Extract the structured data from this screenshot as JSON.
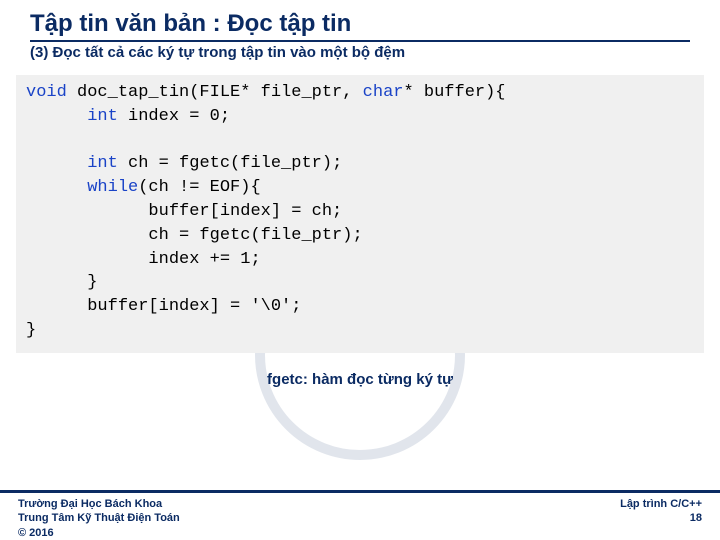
{
  "title": "Tập tin văn bản : Đọc tập tin",
  "subtitle": "(3) Đọc tất cả các ký tự trong tập tin vào một bộ đệm",
  "code": {
    "kw_void": "void",
    "sig": " doc_tap_tin(FILE* file_ptr, ",
    "kw_char": "char",
    "sig2": "* buffer){",
    "kw_int1": "int",
    "l2": " index = 0;",
    "kw_int2": "int",
    "l4": " ch = fgetc(file_ptr);",
    "kw_while": "while",
    "l5": "(ch != EOF){",
    "l6": "buffer[index] = ch;",
    "l7": "ch = fgetc(file_ptr);",
    "l8": "index += 1;",
    "l9": "}",
    "l10": "buffer[index] = '\\0';",
    "l11": "}"
  },
  "note": "fgetc: hàm đọc từng ký tự",
  "footer": {
    "org1": "Trường Đại Học Bách Khoa",
    "org2": "Trung Tâm Kỹ Thuật Điện Toán",
    "copyright": "© 2016",
    "course": "Lập trình C/C++",
    "page": "18"
  }
}
